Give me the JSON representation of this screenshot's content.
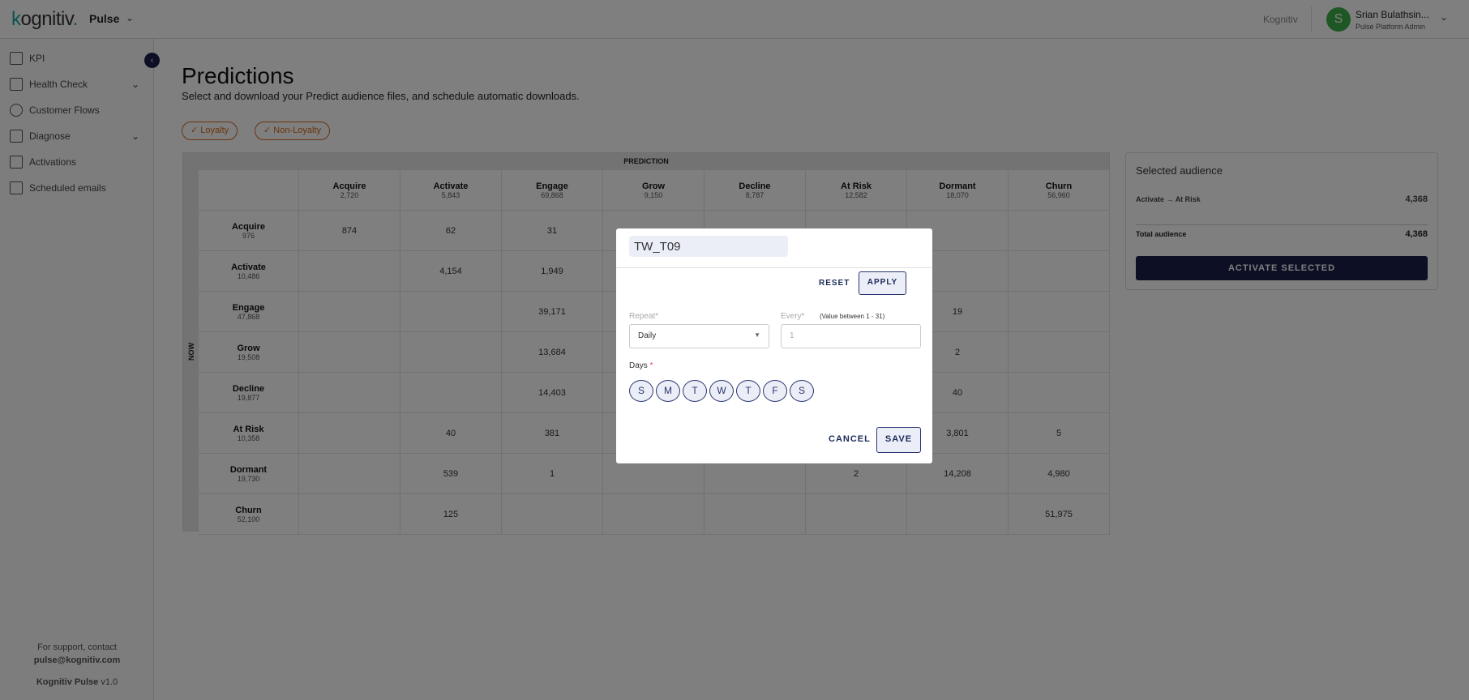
{
  "header": {
    "logo": "kognitiv",
    "app": "Pulse",
    "org": "Kognitiv",
    "user_initial": "S",
    "user_name": "Srian Bulathsin...",
    "user_role": "Pulse Platform Admin"
  },
  "sidebar": {
    "items": [
      {
        "label": "KPI",
        "icon": "dashboard-icon"
      },
      {
        "label": "Health Check",
        "icon": "clipboard-pulse-icon",
        "expandable": true
      },
      {
        "label": "Customer Flows",
        "icon": "flows-icon"
      },
      {
        "label": "Diagnose",
        "icon": "clipboard-pulse-icon",
        "expandable": true
      },
      {
        "label": "Activations",
        "icon": "calendar-icon"
      },
      {
        "label": "Scheduled emails",
        "icon": "mail-icon"
      }
    ],
    "support_text": "For support, contact",
    "support_email": "pulse@kognitiv.com",
    "product": "Kognitiv Pulse",
    "version": "v1.0"
  },
  "page": {
    "title": "Predictions",
    "subtitle": "Select and download your Predict audience files, and schedule automatic downloads.",
    "filters": [
      {
        "label": "Loyalty",
        "checked": true
      },
      {
        "label": "Non-Loyalty",
        "checked": true
      }
    ]
  },
  "table": {
    "col_axis": "PREDICTION",
    "row_axis": "NOW",
    "columns": [
      {
        "name": "Acquire",
        "total": "2,720"
      },
      {
        "name": "Activate",
        "total": "5,843"
      },
      {
        "name": "Engage",
        "total": "69,868"
      },
      {
        "name": "Grow",
        "total": "9,150"
      },
      {
        "name": "Decline",
        "total": "8,787"
      },
      {
        "name": "At Risk",
        "total": "12,582"
      },
      {
        "name": "Dormant",
        "total": "18,070"
      },
      {
        "name": "Churn",
        "total": "56,960"
      }
    ],
    "rows": [
      {
        "name": "Acquire",
        "total": "976",
        "cells": [
          "874",
          "62",
          "31",
          "",
          "",
          "",
          "",
          ""
        ]
      },
      {
        "name": "Activate",
        "total": "10,486",
        "cells": [
          "",
          "4,154",
          "1,949",
          "",
          "",
          "",
          "",
          ""
        ]
      },
      {
        "name": "Engage",
        "total": "47,868",
        "cells": [
          "",
          "",
          "39,171",
          "",
          "",
          "",
          "19",
          ""
        ]
      },
      {
        "name": "Grow",
        "total": "19,508",
        "cells": [
          "",
          "",
          "13,684",
          "",
          "",
          "",
          "2",
          ""
        ]
      },
      {
        "name": "Decline",
        "total": "19,877",
        "cells": [
          "",
          "",
          "14,403",
          "",
          "",
          "",
          "40",
          ""
        ]
      },
      {
        "name": "At Risk",
        "total": "10,358",
        "cells": [
          "",
          "40",
          "381",
          "",
          "",
          "",
          "3,801",
          "5"
        ]
      },
      {
        "name": "Dormant",
        "total": "19,730",
        "cells": [
          "",
          "539",
          "1",
          "",
          "",
          "2",
          "14,208",
          "4,980"
        ]
      },
      {
        "name": "Churn",
        "total": "52,100",
        "cells": [
          "",
          "125",
          "",
          "",
          "",
          "",
          "",
          "51,975"
        ]
      }
    ]
  },
  "audience": {
    "title": "Selected audience",
    "from": "Activate",
    "to": "At Risk",
    "value": "4,368",
    "total_label": "Total audience",
    "total": "4,368",
    "button": "ACTIVATE SELECTED"
  },
  "modal": {
    "name": "TW_T09",
    "reset": "RESET",
    "apply": "APPLY",
    "repeat_label": "Repeat*",
    "repeat_value": "Daily",
    "every_label": "Every*",
    "every_hint": "(Value between 1 - 31)",
    "every_placeholder": "1",
    "days_label": "Days",
    "days_required": "*",
    "days": [
      "S",
      "M",
      "T",
      "W",
      "T",
      "F",
      "S"
    ],
    "cancel": "CANCEL",
    "save": "SAVE"
  },
  "colors": {
    "accent": "#1a1f4a",
    "chip": "#d2691e",
    "avatar": "#3fae49"
  }
}
